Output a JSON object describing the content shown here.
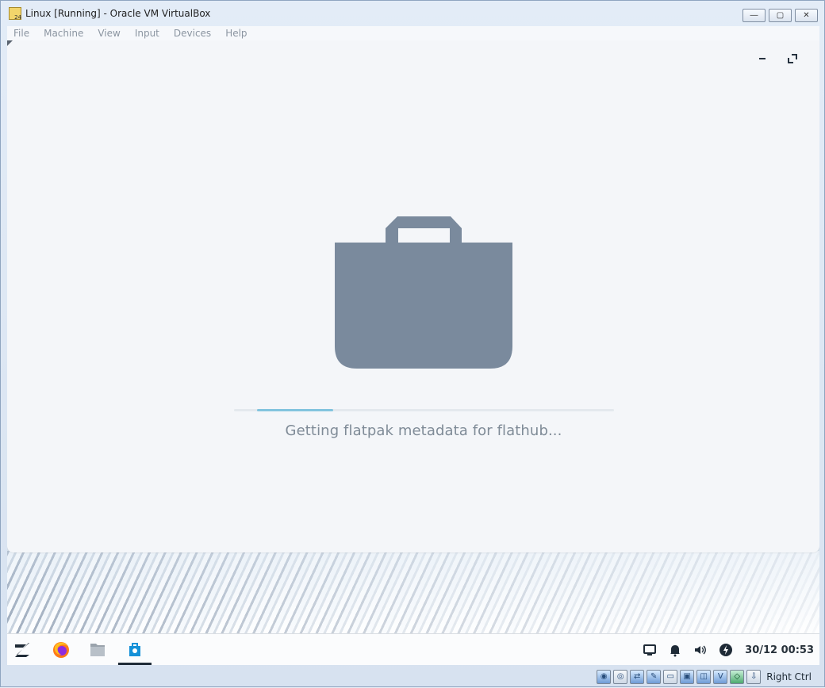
{
  "window": {
    "title": "Linux [Running] - Oracle VM VirtualBox",
    "controls": {
      "minimize": "—",
      "restore": "▢",
      "close": "✕"
    }
  },
  "menubar": {
    "items": [
      "File",
      "Machine",
      "View",
      "Input",
      "Devices",
      "Help"
    ]
  },
  "software_app": {
    "minimize_icon": "minimize-icon",
    "maximize_icon": "maximize-icon",
    "loading_icon": "shopping-bag-icon",
    "progress_fraction": 0.2,
    "progress_start_fraction": 0.06,
    "status_text": "Getting flatpak metadata for flathub..."
  },
  "taskbar": {
    "launchers": [
      "zorin-menu-icon",
      "firefox-icon",
      "files-icon",
      "software-icon"
    ],
    "active": "software-icon",
    "tray": [
      "display-icon",
      "notification-bell-icon",
      "volume-icon",
      "power-icon"
    ],
    "clock": "30/12 00:53"
  },
  "statusbar": {
    "icons": [
      "hard-disk-icon",
      "optical-drive-icon",
      "network-icon",
      "usb-icon",
      "shared-folders-icon",
      "display-icon",
      "video-capture-icon",
      "virtualization-icon",
      "guest-additions-icon",
      "keyboard-capture-icon"
    ],
    "host_key": "Right Ctrl"
  },
  "colors": {
    "store_background": "#f4f6f9",
    "bag": "#7a8a9d",
    "progress": "#82c4de",
    "text": "#7f8b97"
  }
}
